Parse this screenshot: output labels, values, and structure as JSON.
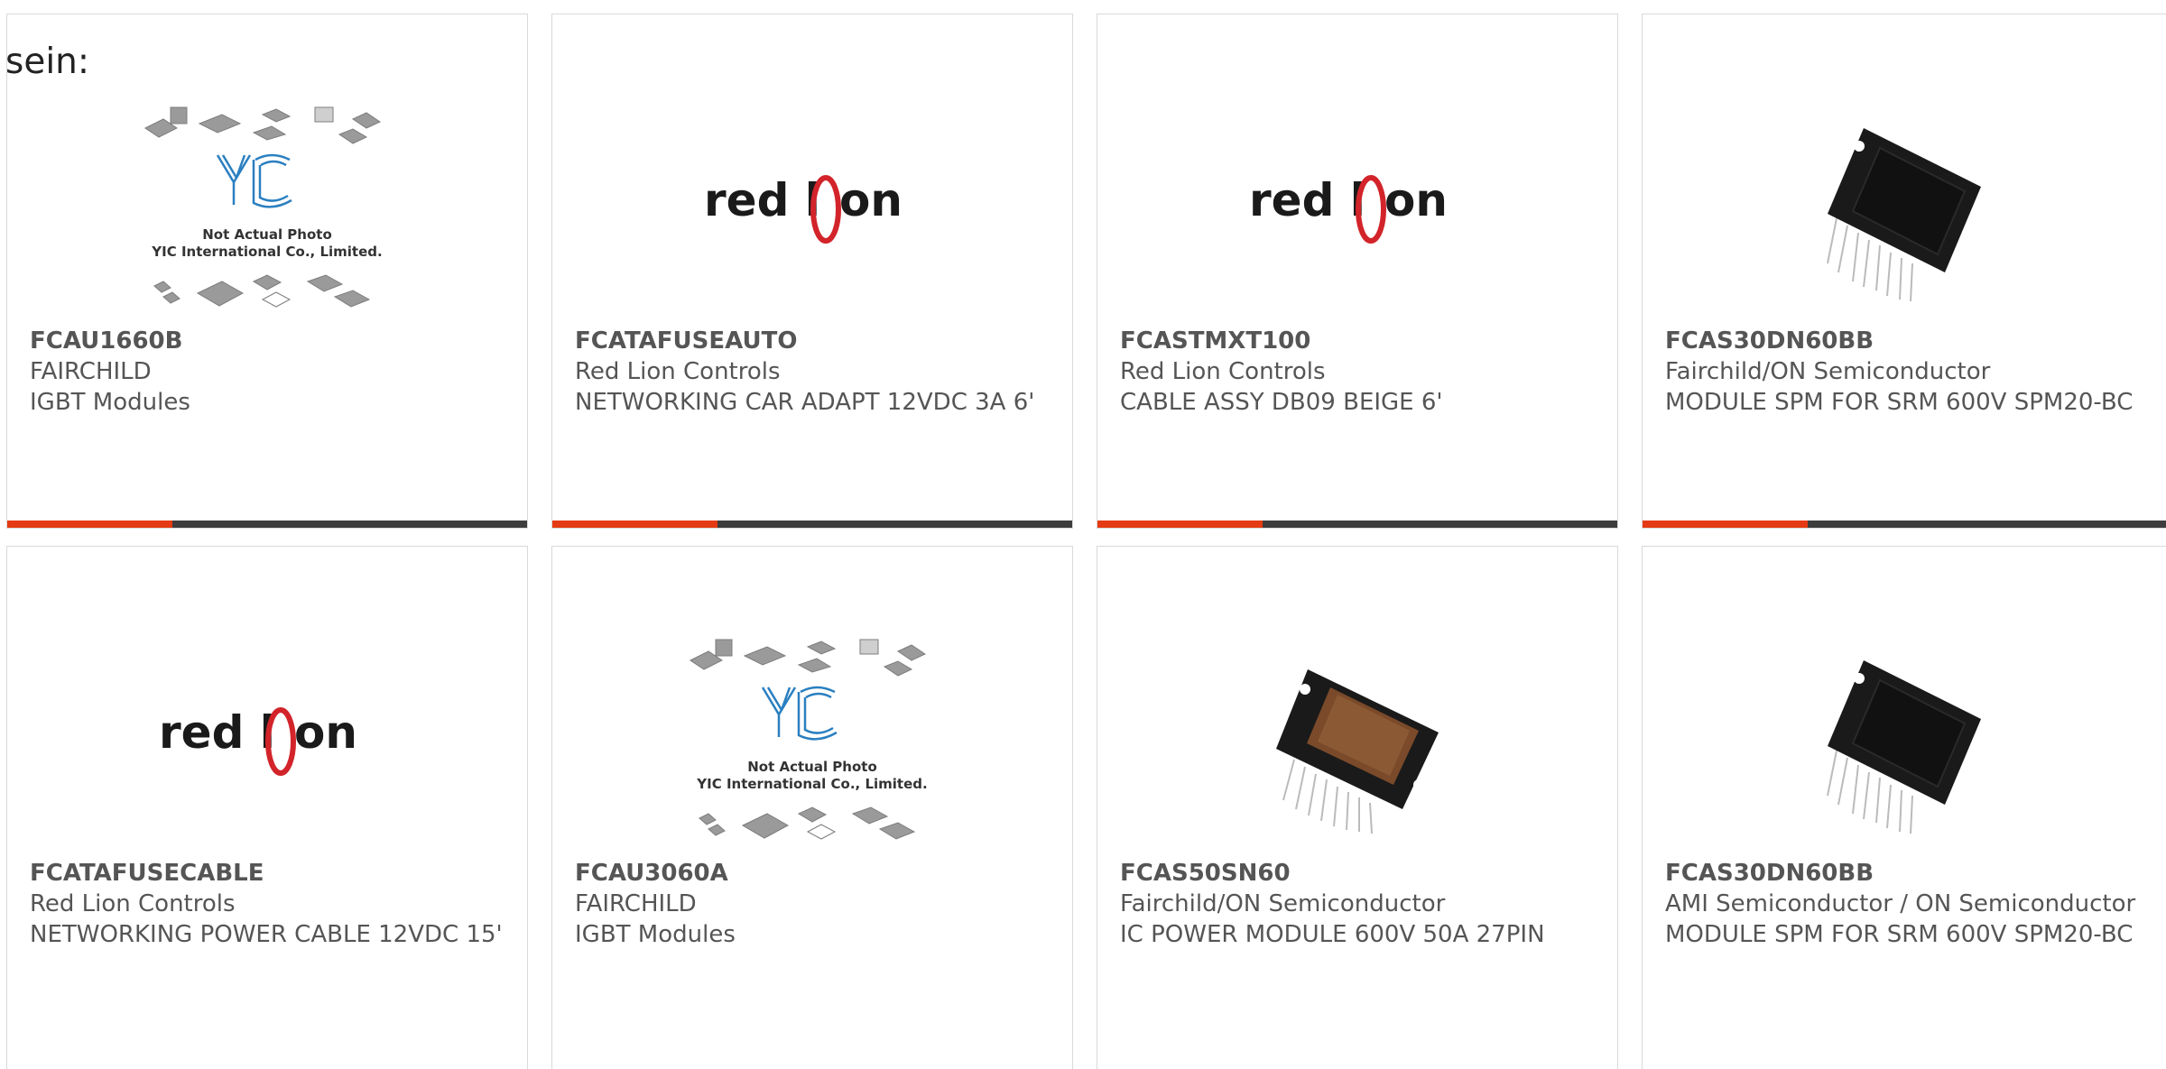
{
  "lead_text": "sein:",
  "colors": {
    "accent": "#e53b14",
    "bar": "#3d3d3d",
    "brand_red": "#d2242a",
    "yic_blue": "#2a7fc0"
  },
  "products": [
    {
      "part": "FCAU1660B",
      "manufacturer": "FAIRCHILD",
      "description": "IGBT Modules",
      "image": "yic-placeholder",
      "placeholder": {
        "line1": "Not Actual Photo",
        "line2": "YIC International Co., Limited.",
        "logo": "YIC"
      }
    },
    {
      "part": "FCATAFUSEAUTO",
      "manufacturer": "Red Lion Controls",
      "description": "NETWORKING CAR ADAPT 12VDC 3A 6'",
      "image": "red-lion-logo",
      "logo": {
        "left": "red l",
        "right": "on"
      }
    },
    {
      "part": "FCASTMXT100",
      "manufacturer": "Red Lion Controls",
      "description": "CABLE ASSY DB09 BEIGE 6'",
      "image": "red-lion-logo",
      "logo": {
        "left": "red l",
        "right": "on"
      }
    },
    {
      "part": "FCAS30DN60BB",
      "manufacturer": "Fairchild/ON Semiconductor",
      "description": "MODULE SPM FOR SRM 600V SPM20-BC",
      "image": "spm-module-black"
    },
    {
      "part": "FCATAFUSECABLE",
      "manufacturer": "Red Lion Controls",
      "description": "NETWORKING POWER CABLE 12VDC 15'",
      "image": "red-lion-logo",
      "logo": {
        "left": "red l",
        "right": "on"
      }
    },
    {
      "part": "FCAU3060A",
      "manufacturer": "FAIRCHILD",
      "description": "IGBT Modules",
      "image": "yic-placeholder",
      "placeholder": {
        "line1": "Not Actual Photo",
        "line2": "YIC International Co., Limited.",
        "logo": "YIC"
      }
    },
    {
      "part": "FCAS50SN60",
      "manufacturer": "Fairchild/ON Semiconductor",
      "description": "IC POWER MODULE 600V 50A 27PIN",
      "image": "power-module-copper"
    },
    {
      "part": "FCAS30DN60BB",
      "manufacturer": "AMI Semiconductor / ON Semiconductor",
      "description": "MODULE SPM FOR SRM 600V SPM20-BC",
      "image": "spm-module-black"
    }
  ]
}
